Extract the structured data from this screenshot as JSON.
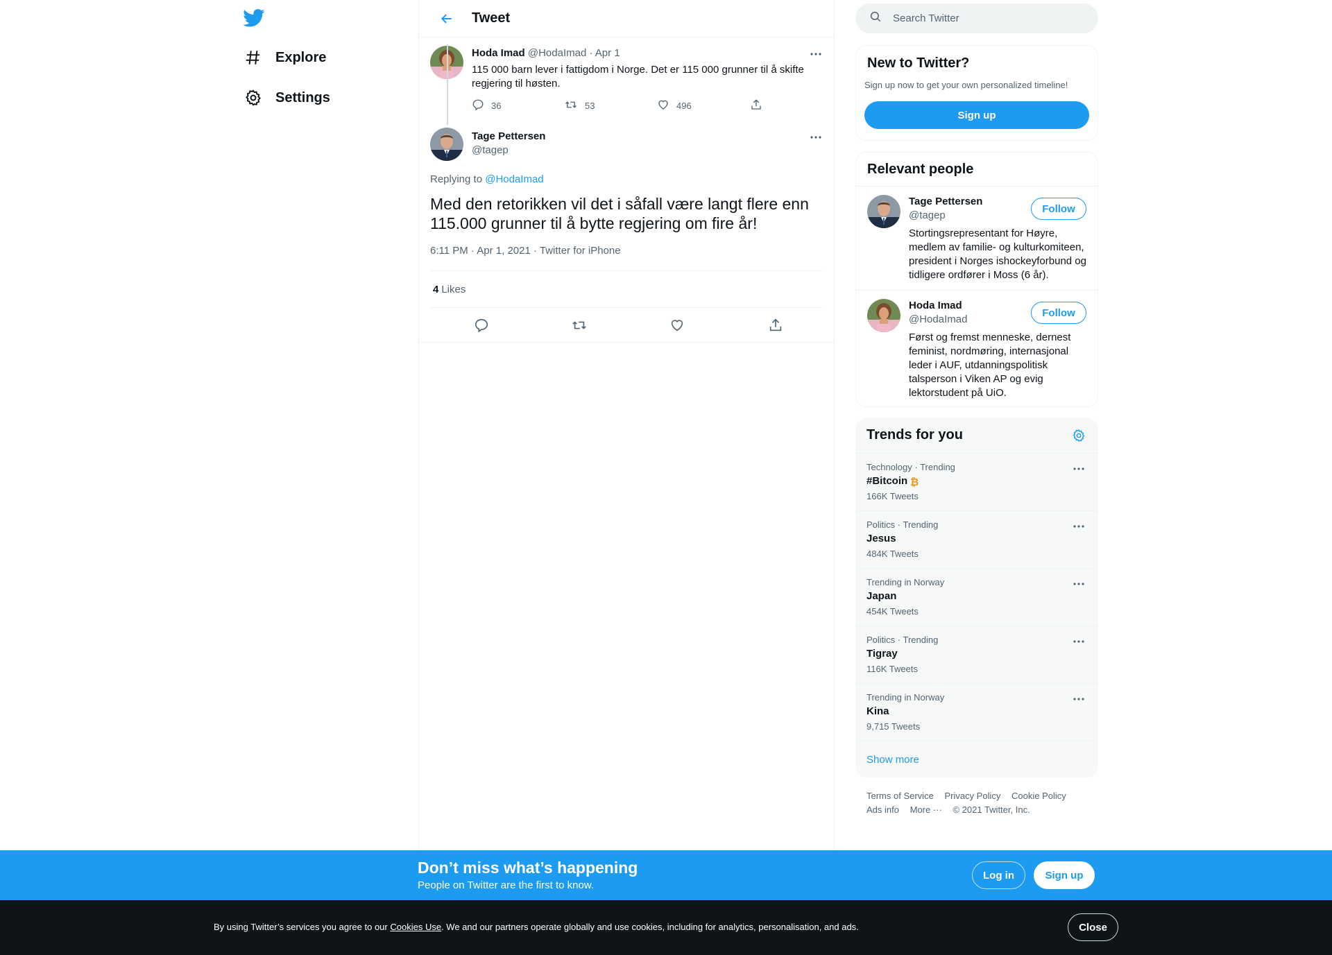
{
  "nav": {
    "explore_label": "Explore",
    "settings_label": "Settings"
  },
  "header": {
    "title": "Tweet"
  },
  "parent_tweet": {
    "name": "Hoda Imad",
    "handle": "@HodaImad",
    "date": "· Apr 1",
    "text": "115 000 barn lever i fattigdom i Norge. Det er 115 000 grunner til å skifte regjering til høsten.",
    "replies": "36",
    "retweets": "53",
    "likes": "496"
  },
  "main_tweet": {
    "name": "Tage Pettersen",
    "handle": "@tagep",
    "replying_prefix": "Replying to",
    "replying_to": "@HodaImad",
    "text": "Med den retorikken vil det i såfall være langt flere enn 115.000 grunner til å bytte regjering om fire år!",
    "meta": "6:11 PM · Apr 1, 2021 · Twitter for iPhone",
    "likes_count": "4",
    "likes_label": "Likes"
  },
  "search": {
    "placeholder": "Search Twitter"
  },
  "new_to_twitter": {
    "title": "New to Twitter?",
    "subtitle": "Sign up now to get your own personalized timeline!",
    "signup_label": "Sign up"
  },
  "relevant_people": {
    "title": "Relevant people",
    "people": [
      {
        "name": "Tage Pettersen",
        "handle": "@tagep",
        "bio": "Stortingsrepresentant for Høyre, medlem av familie- og kulturkomiteen, president i Norges ishockeyforbund og tidligere ordfører i Moss (6 år).",
        "follow_label": "Follow"
      },
      {
        "name": "Hoda Imad",
        "handle": "@HodaImad",
        "bio": "Først og fremst menneske, dernest feminist, nordmøring, internasjonal leder i AUF, utdanningspolitisk talsperson i Viken AP og evig lektorstudent på UiO.",
        "follow_label": "Follow"
      }
    ]
  },
  "trends": {
    "title": "Trends for you",
    "items": [
      {
        "meta": "Technology · Trending",
        "name": "#Bitcoin",
        "count": "166K Tweets"
      },
      {
        "meta": "Politics · Trending",
        "name": "Jesus",
        "count": "484K Tweets"
      },
      {
        "meta": "Trending in Norway",
        "name": "Japan",
        "count": "454K Tweets"
      },
      {
        "meta": "Politics · Trending",
        "name": "Tigray",
        "count": "116K Tweets"
      },
      {
        "meta": "Trending in Norway",
        "name": "Kina",
        "count": "9,715 Tweets"
      }
    ],
    "show_more": "Show more"
  },
  "footer": {
    "terms": "Terms of Service",
    "privacy": "Privacy Policy",
    "cookie": "Cookie Policy",
    "ads": "Ads info",
    "more": "More ···",
    "copyright": "© 2021 Twitter, Inc."
  },
  "banner": {
    "title": "Don’t miss what’s happening",
    "subtitle": "People on Twitter are the first to know.",
    "login_label": "Log in",
    "signup_label": "Sign up"
  },
  "cookie_bar": {
    "text_before": "By using Twitter’s services you agree to our ",
    "link": "Cookies Use",
    "text_after": ". We and our partners operate globally and use cookies, including for analytics, personalisation, and ads.",
    "close_label": "Close"
  },
  "colors": {
    "accent": "#1d9bf0",
    "text": "#0f1419",
    "muted": "#536471",
    "border": "#eff3f4",
    "cookie_bg": "#0f1419",
    "bitcoin": "#f7931a"
  },
  "icons": [
    "twitter-logo-icon",
    "hashtag-icon",
    "gear-icon",
    "back-arrow-icon",
    "more-icon",
    "reply-icon",
    "retweet-icon",
    "like-icon",
    "share-icon",
    "search-icon",
    "bitcoin-icon"
  ]
}
